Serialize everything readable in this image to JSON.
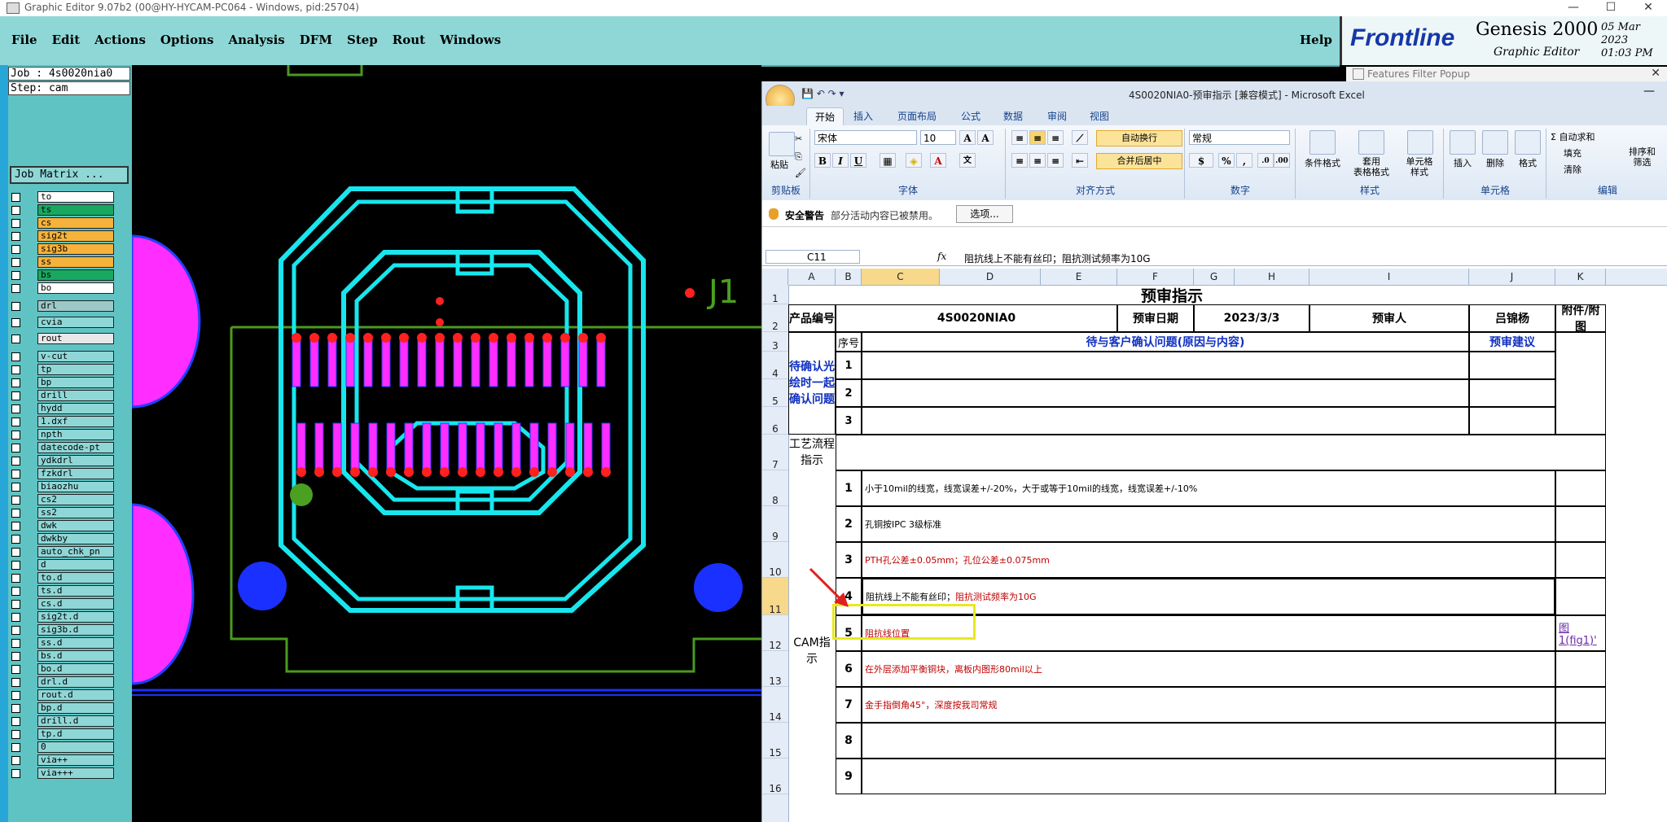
{
  "genesis": {
    "window_title": "Graphic Editor 9.07b2 (00@HY-HYCAM-PC064 - Windows, pid:25704)",
    "menu": [
      "File",
      "Edit",
      "Actions",
      "Options",
      "Analysis",
      "DFM",
      "Step",
      "Rout",
      "Windows"
    ],
    "help": "Help",
    "brand": {
      "logo": "Frontline",
      "product": "Genesis 2000",
      "subtitle": "Graphic Editor",
      "date": "05 Mar 2023",
      "time": "01:03 PM"
    },
    "job": "Job : 4s0020nia0",
    "step": "Step: cam",
    "job_matrix": "Job Matrix ...",
    "label_j1": "J1",
    "layers": [
      {
        "name": "to",
        "color": "#ffffff"
      },
      {
        "name": "ts",
        "color": "#18a860"
      },
      {
        "name": "cs",
        "color": "#f6b23a"
      },
      {
        "name": "sig2t",
        "color": "#f6b23a"
      },
      {
        "name": "sig3b",
        "color": "#f6b23a"
      },
      {
        "name": "ss",
        "color": "#f6b23a"
      },
      {
        "name": "bs",
        "color": "#18a860"
      },
      {
        "name": "bo",
        "color": "#ffffff"
      },
      {
        "name": "drl",
        "color": "#9ec8c8"
      },
      {
        "name": "cvia",
        "color": "#8fd7d7"
      },
      {
        "name": "rout",
        "color": "#e8e8e8"
      },
      {
        "name": "v-cut",
        "color": "#8fd7d7"
      },
      {
        "name": "tp",
        "color": "#8fd7d7"
      },
      {
        "name": "bp",
        "color": "#8fd7d7"
      },
      {
        "name": "drill",
        "color": "#8fd7d7"
      },
      {
        "name": "hydd",
        "color": "#8fd7d7"
      },
      {
        "name": "1.dxf",
        "color": "#8fd7d7"
      },
      {
        "name": "npth",
        "color": "#8fd7d7"
      },
      {
        "name": "datecode-pt",
        "color": "#8fd7d7"
      },
      {
        "name": "ydkdrl",
        "color": "#8fd7d7"
      },
      {
        "name": "fzkdrl",
        "color": "#8fd7d7"
      },
      {
        "name": "biaozhu",
        "color": "#8fd7d7"
      },
      {
        "name": "cs2",
        "color": "#8fd7d7"
      },
      {
        "name": "ss2",
        "color": "#8fd7d7"
      },
      {
        "name": "dwk",
        "color": "#8fd7d7"
      },
      {
        "name": "dwkby",
        "color": "#8fd7d7"
      },
      {
        "name": "auto_chk_pn",
        "color": "#8fd7d7"
      },
      {
        "name": "d",
        "color": "#8fd7d7"
      },
      {
        "name": "to.d",
        "color": "#8fd7d7"
      },
      {
        "name": "ts.d",
        "color": "#8fd7d7"
      },
      {
        "name": "cs.d",
        "color": "#8fd7d7"
      },
      {
        "name": "sig2t.d",
        "color": "#8fd7d7"
      },
      {
        "name": "sig3b.d",
        "color": "#8fd7d7"
      },
      {
        "name": "ss.d",
        "color": "#8fd7d7"
      },
      {
        "name": "bs.d",
        "color": "#8fd7d7"
      },
      {
        "name": "bo.d",
        "color": "#8fd7d7"
      },
      {
        "name": "drl.d",
        "color": "#8fd7d7"
      },
      {
        "name": "rout.d",
        "color": "#8fd7d7"
      },
      {
        "name": "bp.d",
        "color": "#8fd7d7"
      },
      {
        "name": "drill.d",
        "color": "#8fd7d7"
      },
      {
        "name": "tp.d",
        "color": "#8fd7d7"
      },
      {
        "name": "0",
        "color": "#8fd7d7"
      },
      {
        "name": "via++",
        "color": "#8fd7d7"
      },
      {
        "name": "via+++",
        "color": "#8fd7d7"
      }
    ]
  },
  "popup_title": "Features Filter Popup",
  "excel": {
    "title": "4S0020NIA0-预审指示  [兼容模式] - Microsoft Excel",
    "tabs": [
      "开始",
      "插入",
      "页面布局",
      "公式",
      "数据",
      "审阅",
      "视图"
    ],
    "ribbon": {
      "paste": "粘贴",
      "clipboard": "剪贴板",
      "font_name": "宋体",
      "font_size": "10",
      "font_group": "字体",
      "wrap": "自动换行",
      "merge": "合并后居中",
      "align_group": "对齐方式",
      "number_format": "常规",
      "number_group": "数字",
      "cond_format": "条件格式",
      "table_format": "套用\n表格格式",
      "cell_style": "单元格\n样式",
      "style_group": "样式",
      "insert": "插入",
      "delete": "删除",
      "format": "格式",
      "cells_group": "单元格",
      "autosum": "Σ 自动求和",
      "fill": "填充",
      "clear": "清除",
      "sort": "排序和\n筛选",
      "edit_group": "编辑"
    },
    "security": {
      "title": "安全警告",
      "message": "部分活动内容已被禁用。",
      "button": "选项..."
    },
    "name_box": "C11",
    "formula": "阻抗线上不能有丝印；阻抗测试频率为10G",
    "columns": [
      "A",
      "B",
      "C",
      "D",
      "E",
      "F",
      "G",
      "H",
      "I",
      "J",
      "K"
    ],
    "rows": [
      "1",
      "2",
      "3",
      "4",
      "5",
      "6",
      "7",
      "8",
      "9",
      "10",
      "11",
      "12",
      "13",
      "14",
      "15",
      "16"
    ],
    "sheet": {
      "title": "预审指示",
      "product_label": "产品编号",
      "product_no": "4S0020NIA0",
      "date_label": "预审日期",
      "date": "2023/3/3",
      "reviewer_label": "预审人",
      "reviewer": "吕锦杨",
      "attach_label": "附件/附图",
      "seq_label": "序号",
      "question_header": "待与客户确认问题(原因与内容)",
      "suggest_header": "预审建议",
      "confirm_label": "待确认光绘时一起确认问题",
      "process_label": "工艺流程指示",
      "cam_label": "CAM指示",
      "confirm_nums": [
        "1",
        "2",
        "3"
      ],
      "cam_items": [
        {
          "n": "1",
          "text": "小于10mil的线宽，线宽误差+/-20%，大于或等于10mil的线宽，线宽误差+/-10%",
          "red": false
        },
        {
          "n": "2",
          "text": "孔铜按IPC 3级标准",
          "red": false
        },
        {
          "n": "3",
          "text": "PTH孔公差±0.05mm；孔位公差±0.075mm",
          "red": true
        },
        {
          "n": "4",
          "text_a": "阻抗线上不能有丝印；",
          "text_b": "阻抗测试频率为10G",
          "red": true
        },
        {
          "n": "5",
          "text": "阻抗线位置",
          "red": true,
          "link": "图1(fig1)'"
        },
        {
          "n": "6",
          "text": "在外层添加平衡铜块，离板内图形80mil以上",
          "red": true
        },
        {
          "n": "7",
          "text": "金手指倒角45°，深度按我司常规",
          "red": true
        },
        {
          "n": "8",
          "text": "",
          "red": false
        },
        {
          "n": "9",
          "text": "",
          "red": false
        }
      ]
    }
  }
}
